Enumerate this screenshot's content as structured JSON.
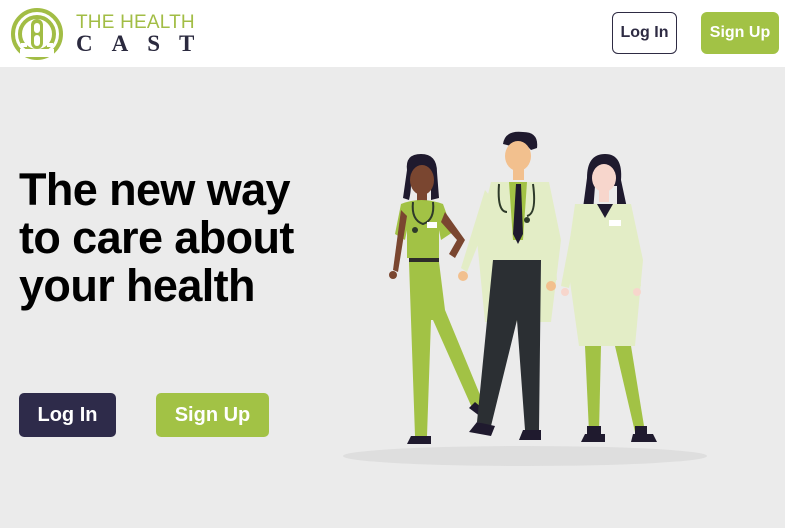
{
  "header": {
    "logo": {
      "line1": "THE HEALTH",
      "line2": "CAST",
      "icon": "podcast-icon",
      "colors": {
        "green": "#a2bd45",
        "dark": "#2b2a3f"
      }
    },
    "login_label": "Log In",
    "signup_label": "Sign Up"
  },
  "hero": {
    "headline": "The new way to care about your health",
    "login_label": "Log In",
    "signup_label": "Sign Up",
    "illustration": "three-doctors-illustration"
  },
  "colors": {
    "accent": "#a2c245",
    "dark": "#2e2b4a",
    "background": "#ebebeb"
  }
}
